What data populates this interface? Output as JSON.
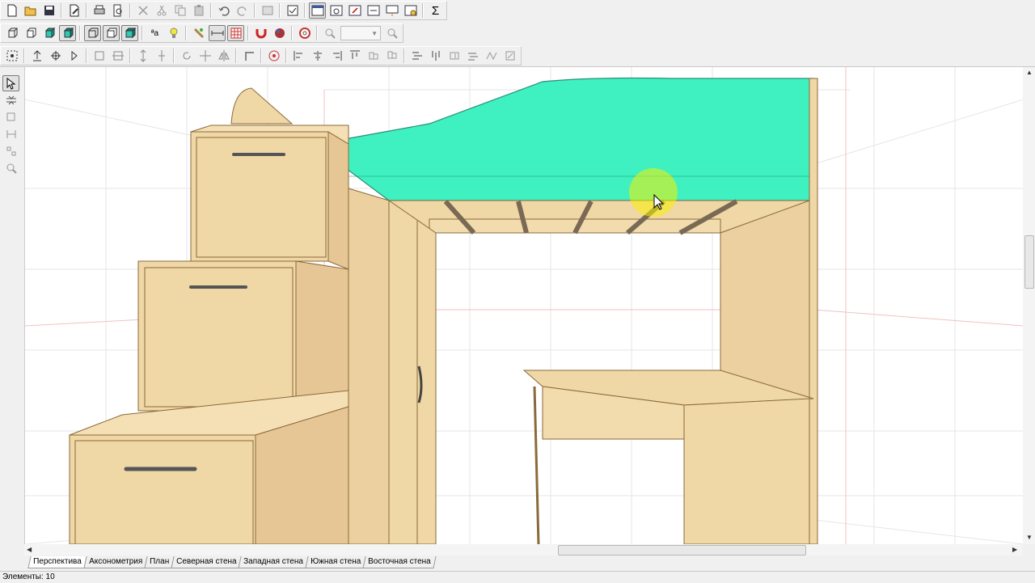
{
  "tabs": [
    {
      "label": "Перспектива",
      "active": true
    },
    {
      "label": "Аксонометрия",
      "active": false
    },
    {
      "label": "План",
      "active": false
    },
    {
      "label": "Северная стена",
      "active": false
    },
    {
      "label": "Западная стена",
      "active": false
    },
    {
      "label": "Южная стена",
      "active": false
    },
    {
      "label": "Восточная стена",
      "active": false
    }
  ],
  "status": {
    "elements": "Элементы: 10"
  },
  "toolbar": {
    "sum_symbol": "Σ",
    "text_format_label": "ªa",
    "zoom_value": ""
  },
  "colors": {
    "mattress": "#3ff0c0",
    "wood": "#f0d7a6",
    "wood_dark": "#d9b985",
    "wood_edge": "#8a6a3a",
    "highlight": "#f5f000"
  },
  "icons": {
    "row1": [
      "new-file-icon",
      "open-folder-icon",
      "save-icon",
      "edit-file-icon",
      "print-icon",
      "print-preview-icon",
      "cut-icon",
      "cut-alt-icon",
      "copy-icon",
      "paste-icon",
      "undo-icon",
      "redo-icon",
      "properties-icon",
      "checklist-icon",
      "view-window-icon",
      "view-zoom-icon",
      "export-icon",
      "export-alt-icon",
      "import-icon",
      "settings-window-icon",
      "sum-icon"
    ],
    "row2": [
      "cube-wire-icon",
      "cube-outline-icon",
      "cube-shaded-icon",
      "cube-solid-icon",
      "box-wire-icon",
      "box-outline-icon",
      "box-solid-icon",
      "text-format-icon",
      "lightbulb-icon",
      "texture-icon",
      "dimension-icon",
      "grid-icon",
      "magnet-icon",
      "color-palette-icon",
      "lifebuoy-icon",
      "zoom-in-icon",
      "zoom-out-icon"
    ],
    "row3": [
      "snap-grid-icon",
      "move-up-icon",
      "rotate-axis-icon",
      "rotate-icon",
      "frame-icon",
      "frame-alt-icon",
      "align-vertical-icon",
      "align-vertical-alt-icon",
      "rotate-cw-icon",
      "move-icon",
      "mirror-icon",
      "corner-icon",
      "target-icon",
      "align-left-icon",
      "align-center-icon",
      "align-right-icon",
      "align-top-icon",
      "align-middle-icon",
      "align-bottom-icon",
      "distribute-h-icon",
      "distribute-v-icon",
      "group-icon",
      "ungroup-icon"
    ],
    "left": [
      "select-arrow-icon",
      "layers-icon",
      "frame-tool-icon",
      "measure-icon",
      "node-tool-icon",
      "zoom-tool-icon"
    ]
  }
}
